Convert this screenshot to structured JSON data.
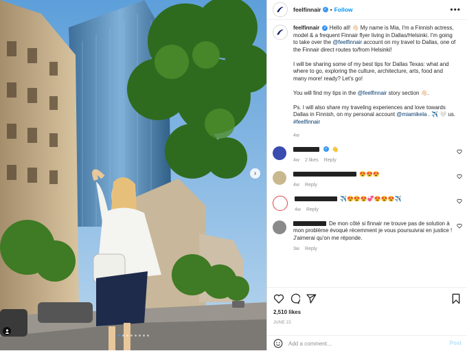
{
  "post": {
    "username": "feelfinnair",
    "follow_separator": "•",
    "follow_label": "Follow",
    "more_label": "•••",
    "carousel": {
      "slide_count": 8,
      "active_index": 0,
      "next_arrow": "›",
      "user_tag_icon": "person-icon"
    }
  },
  "caption": {
    "username": "feelfinnair",
    "line1": "Hello all! 👋🏻 My name is Mia, I'm a Finnish actress, model & a frequent Finnair flyer living in Dallas/Helsinki. I'm going to take over the ",
    "mention1": "@feelfinnair",
    "line1b": " account on my travel to Dallas, one of the Finnair direct routes to/from Helsinki!",
    "para2": "I will be sharing some of my best tips for Dallas Texas: what and where to go, exploring the culture, architecture, arts, food and many more! ready? Let's go!",
    "para3a": "You will find my tips in the ",
    "mention2": "@feelfinnair",
    "para3b": " story section 👋🏻.",
    "para4a": "Ps. I will also share my traveling experiences and love towards Dallas in Finnish, on my personal account ",
    "mention3": "@miamikela",
    "para4b": " . ✈️ 🤍 us.",
    "hashtag": "#feelfinnair",
    "age": "4w"
  },
  "comments": [
    {
      "text": "👋",
      "age": "4w",
      "likes": "2 likes",
      "reply": "Reply",
      "avatar_color": "#3a4cb0",
      "verified": true
    },
    {
      "text": "😍😍😍",
      "age": "4w",
      "likes": "",
      "reply": "Reply",
      "avatar_color": "#c9b78e",
      "verified": false
    },
    {
      "text": "✈️😍😍😍💞😍😍😍✈️",
      "age": "4w",
      "likes": "",
      "reply": "Reply",
      "avatar_color": "#ffffff",
      "verified": false
    },
    {
      "text": "De mon côté si finnair ne trouve pas de solution à mon problème évoqué récemment je vous poursuivrai en justice ! J'aimerai qu'on me réponde.",
      "age": "3w",
      "likes": "",
      "reply": "Reply",
      "avatar_color": "#8a8a8a",
      "verified": false
    }
  ],
  "engagement": {
    "likes": "2,510 likes",
    "date": "JUNE 22"
  },
  "comment_box": {
    "placeholder": "Add a comment…",
    "post_label": "Post"
  },
  "colors": {
    "accent": "#0095f6",
    "verified": "#3897f0",
    "muted_text": "#8e8e8e"
  }
}
